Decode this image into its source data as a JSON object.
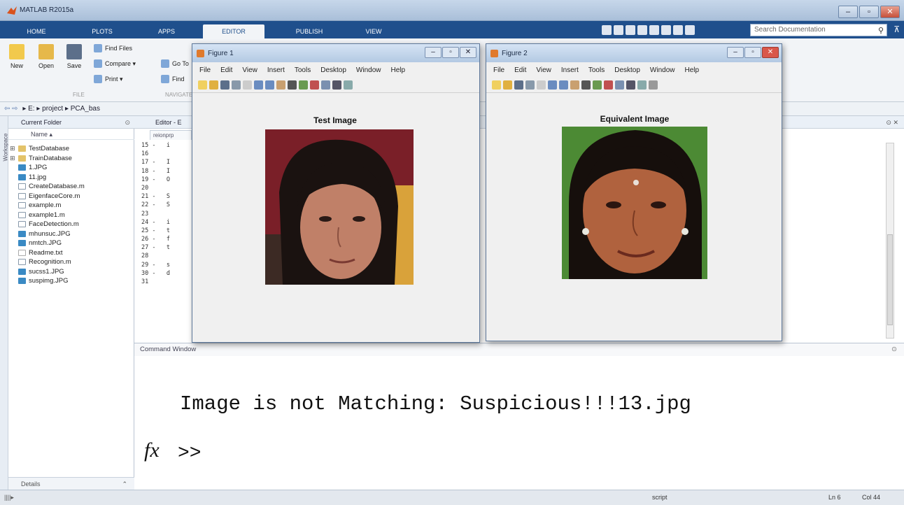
{
  "app": {
    "title": "MATLAB R2015a",
    "window_buttons": [
      "–",
      "▫",
      "✕"
    ]
  },
  "ribbon": {
    "tabs": [
      "HOME",
      "PLOTS",
      "APPS",
      "EDITOR",
      "PUBLISH",
      "VIEW"
    ],
    "active_tab": "EDITOR",
    "search_placeholder": "Search Documentation",
    "file_group": {
      "label": "FILE",
      "new": "New",
      "open": "Open",
      "save": "Save",
      "find_files": "Find Files",
      "compare": "Compare ▾",
      "print": "Print ▾"
    },
    "navigate_group": {
      "label": "NAVIGATE",
      "goto": "Go To",
      "find": "Find"
    }
  },
  "address": {
    "path": "▸ E: ▸ project ▸ PCA_bas"
  },
  "current_folder": {
    "title": "Current Folder",
    "column": "Name ▴",
    "workspace_label": "Workspace",
    "files": [
      {
        "name": "TestDatabase",
        "kind": "folder"
      },
      {
        "name": "TrainDatabase",
        "kind": "folder"
      },
      {
        "name": "1.JPG",
        "kind": "img"
      },
      {
        "name": "11.jpg",
        "kind": "img"
      },
      {
        "name": "CreateDatabase.m",
        "kind": "m"
      },
      {
        "name": "EigenfaceCore.m",
        "kind": "m"
      },
      {
        "name": "example.m",
        "kind": "m"
      },
      {
        "name": "example1.m",
        "kind": "m"
      },
      {
        "name": "FaceDetection.m",
        "kind": "m"
      },
      {
        "name": "mhunsuc.JPG",
        "kind": "img"
      },
      {
        "name": "nmtch.JPG",
        "kind": "img"
      },
      {
        "name": "Readme.txt",
        "kind": "txt"
      },
      {
        "name": "Recognition.m",
        "kind": "m"
      },
      {
        "name": "sucss1.JPG",
        "kind": "img"
      },
      {
        "name": "suspimg.JPG",
        "kind": "img"
      }
    ],
    "details": "Details"
  },
  "editor": {
    "title": "Editor - E",
    "tab": "reionprp",
    "lines": [
      "15 -   i",
      "16",
      "17 -   I",
      "18 -   I",
      "19 -   O",
      "20",
      "21 -   S",
      "22 -   S",
      "23",
      "24 -   i",
      "25 -   t",
      "26 -   f",
      "27 -   t",
      "28",
      "29 -   s",
      "30 -   d",
      "31"
    ]
  },
  "command_window": {
    "title": "Command Window",
    "output": "Image is not Matching: Suspicious!!!13.jpg",
    "fx": "fx",
    "prompt": ">>"
  },
  "figure1": {
    "title": "Figure 1",
    "menu": [
      "File",
      "Edit",
      "View",
      "Insert",
      "Tools",
      "Desktop",
      "Window",
      "Help"
    ],
    "axes_title": "Test Image"
  },
  "figure2": {
    "title": "Figure 2",
    "menu": [
      "File",
      "Edit",
      "View",
      "Insert",
      "Tools",
      "Desktop",
      "Window",
      "Help"
    ],
    "axes_title": "Equivalent Image"
  },
  "statusbar": {
    "left": "||||▸",
    "mode": "script",
    "ln": "Ln  6",
    "col": "Col  44"
  },
  "colors": {
    "ribbon_blue": "#1f4f8c",
    "accent": "#3a8ac4"
  }
}
